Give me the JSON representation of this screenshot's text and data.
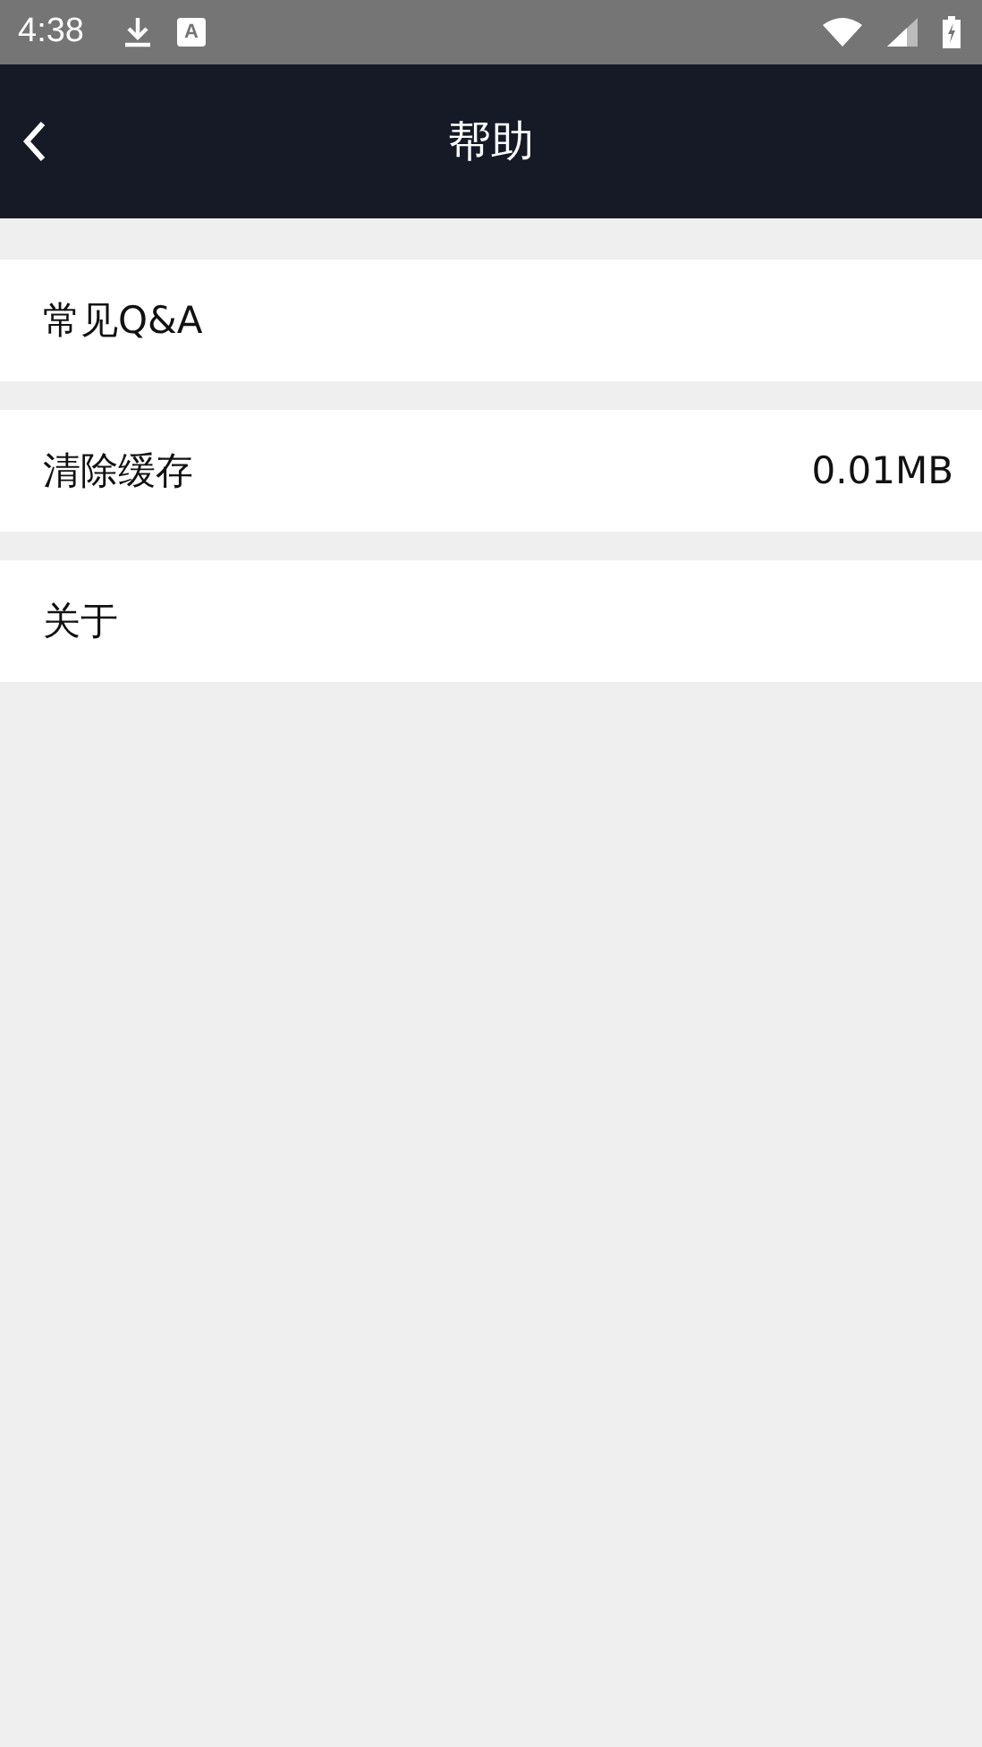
{
  "status_bar": {
    "time": "4:38",
    "notification_letter": "A"
  },
  "header": {
    "title": "帮助"
  },
  "items": [
    {
      "label": "常见Q&A"
    },
    {
      "label": "清除缓存",
      "value": "0.01MB"
    },
    {
      "label": "关于"
    }
  ]
}
